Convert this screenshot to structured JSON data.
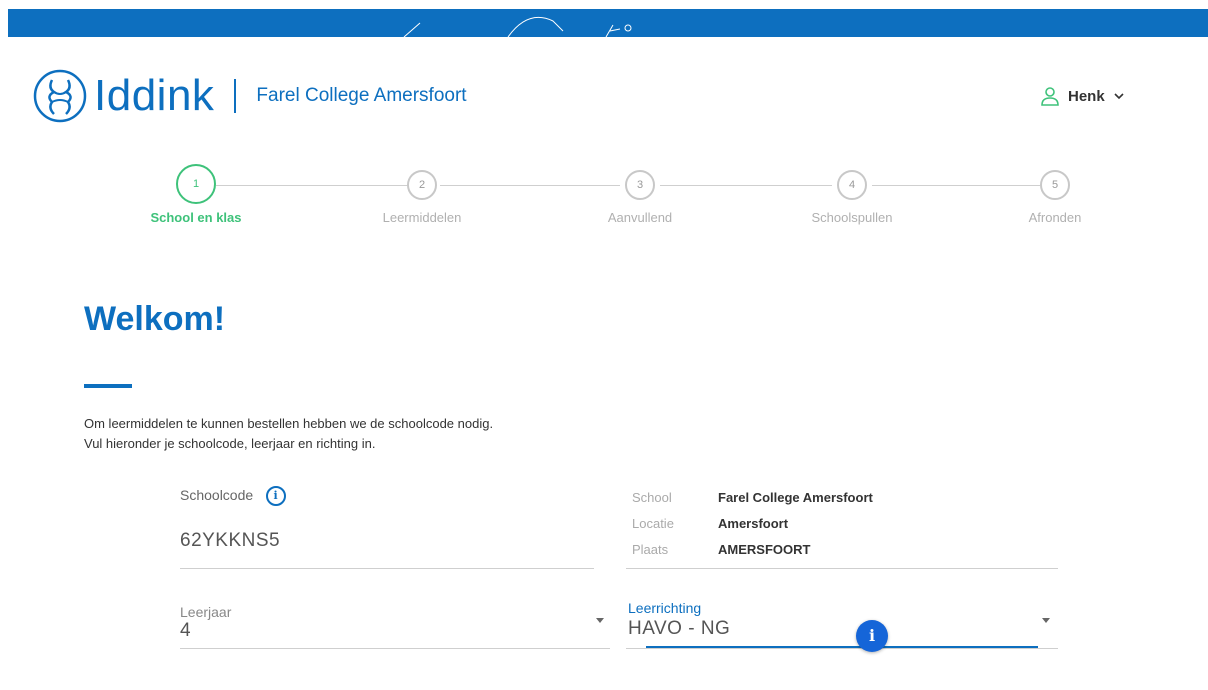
{
  "brand": {
    "name": "Iddink",
    "school_name": "Farel College Amersfoort",
    "color": "#0d6fbf"
  },
  "user": {
    "name": "Henk"
  },
  "steps": [
    {
      "number": "1",
      "label": "School en klas",
      "active": true
    },
    {
      "number": "2",
      "label": "Leermiddelen",
      "active": false
    },
    {
      "number": "3",
      "label": "Aanvullend",
      "active": false
    },
    {
      "number": "4",
      "label": "Schoolspullen",
      "active": false
    },
    {
      "number": "5",
      "label": "Afronden",
      "active": false
    }
  ],
  "page": {
    "title": "Welkom!",
    "intro_line1": "Om leermiddelen te kunnen bestellen hebben we de schoolcode nodig.",
    "intro_line2": "Vul hieronder je schoolcode, leerjaar en richting in."
  },
  "form": {
    "schoolcode_label": "Schoolcode",
    "schoolcode_value": "62YKKNS5",
    "school_info": [
      {
        "key": "School",
        "value": "Farel College Amersfoort"
      },
      {
        "key": "Locatie",
        "value": "Amersfoort"
      },
      {
        "key": "Plaats",
        "value": "AMERSFOORT"
      }
    ],
    "leerjaar_label": "Leerjaar",
    "leerjaar_value": "4",
    "leerrichting_label": "Leerrichting",
    "leerrichting_value": "HAVO - NG"
  },
  "icons": {
    "info_outline": "i",
    "info_fill": "i"
  },
  "colors": {
    "active_step": "#3ec27a",
    "accent_info": "#1565d8"
  }
}
